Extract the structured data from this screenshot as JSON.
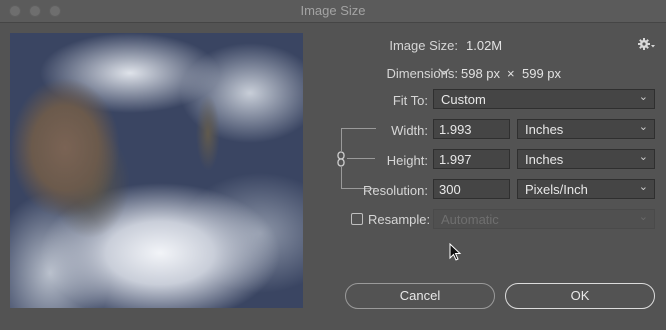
{
  "window": {
    "title": "Image Size"
  },
  "info": {
    "image_size_label": "Image Size:",
    "image_size_value": "1.02M",
    "dimensions_label": "Dimensions:",
    "dim_width": "598 px",
    "dim_sep": "×",
    "dim_height": "599 px"
  },
  "fit_to": {
    "label": "Fit To:",
    "value": "Custom"
  },
  "width": {
    "label": "Width:",
    "value": "1.993",
    "unit": "Inches"
  },
  "height": {
    "label": "Height:",
    "value": "1.997",
    "unit": "Inches"
  },
  "resolution": {
    "label": "Resolution:",
    "value": "300",
    "unit": "Pixels/Inch"
  },
  "resample": {
    "label": "Resample:",
    "value": "Automatic",
    "checked": false
  },
  "buttons": {
    "cancel": "Cancel",
    "ok": "OK"
  },
  "icons": {
    "settings": "gear-icon",
    "link": "chain-link-icon",
    "dropdown": "chevron-down-icon"
  }
}
